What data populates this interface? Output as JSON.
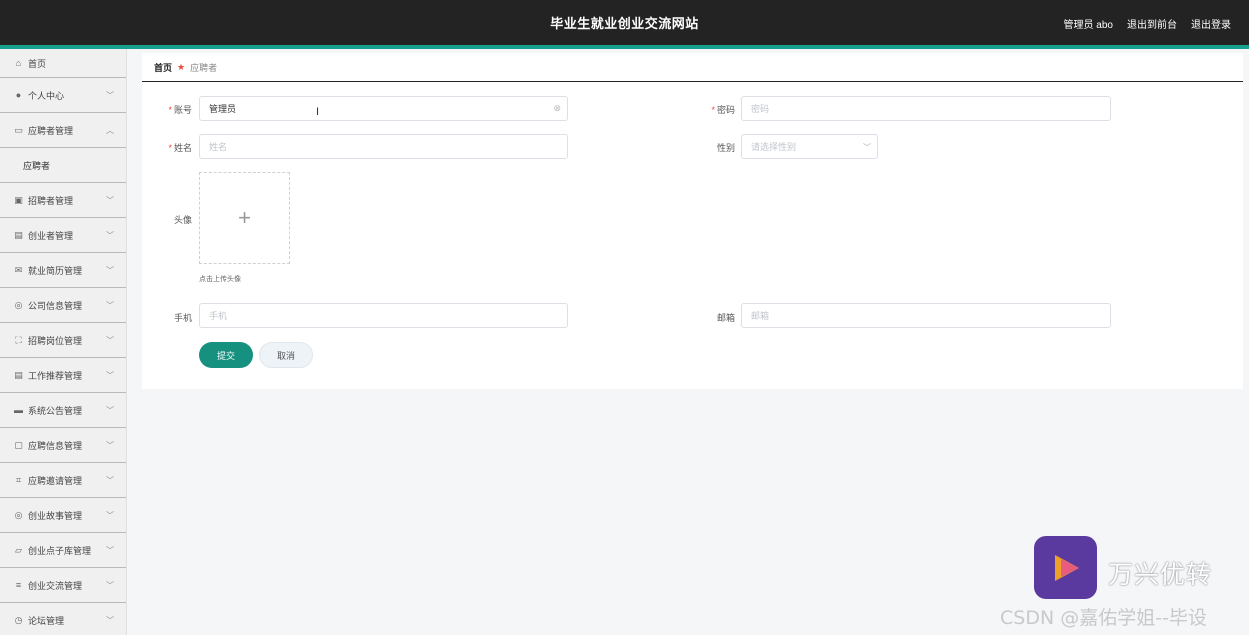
{
  "header": {
    "title": "毕业生就业创业交流网站",
    "user_label": "管理员 abo",
    "back_to_front": "退出到前台",
    "logout": "退出登录"
  },
  "sidebar": {
    "items": [
      {
        "label": "首页",
        "icon": "home-icon",
        "glyph": "⌂"
      },
      {
        "label": "个人中心",
        "icon": "user-icon",
        "glyph": "●"
      },
      {
        "label": "应聘者管理",
        "icon": "monitor-icon",
        "glyph": "▭"
      },
      {
        "label": "应聘者",
        "icon": "",
        "glyph": ""
      },
      {
        "label": "招聘者管理",
        "icon": "doc-icon",
        "glyph": "▣"
      },
      {
        "label": "创业者管理",
        "icon": "clipboard-icon",
        "glyph": "▤"
      },
      {
        "label": "就业简历管理",
        "icon": "mail-icon",
        "glyph": "✉"
      },
      {
        "label": "公司信息管理",
        "icon": "compass-icon",
        "glyph": "◎"
      },
      {
        "label": "招聘岗位管理",
        "icon": "frame-icon",
        "glyph": "⛶"
      },
      {
        "label": "工作推荐管理",
        "icon": "clipboard-icon",
        "glyph": "▤"
      },
      {
        "label": "系统公告管理",
        "icon": "briefcase-icon",
        "glyph": "▬"
      },
      {
        "label": "应聘信息管理",
        "icon": "chart-icon",
        "glyph": "▢"
      },
      {
        "label": "应聘邀请管理",
        "icon": "crop-icon",
        "glyph": "⌗"
      },
      {
        "label": "创业故事管理",
        "icon": "compass-icon",
        "glyph": "◎"
      },
      {
        "label": "创业点子库管理",
        "icon": "chat-icon",
        "glyph": "▱"
      },
      {
        "label": "创业交流管理",
        "icon": "list-icon",
        "glyph": "≡"
      },
      {
        "label": "论坛管理",
        "icon": "clock-icon",
        "glyph": "◷"
      }
    ]
  },
  "breadcrumb": {
    "home": "首页",
    "current": "应聘者"
  },
  "form": {
    "account_label": "账号",
    "account_value": "管理员",
    "password_label": "密码",
    "password_placeholder": "密码",
    "name_label": "姓名",
    "name_placeholder": "姓名",
    "gender_label": "性别",
    "gender_placeholder": "请选择性别",
    "avatar_label": "头像",
    "avatar_tip": "点击上传头像",
    "phone_label": "手机",
    "phone_placeholder": "手机",
    "email_label": "邮箱",
    "email_placeholder": "邮箱",
    "submit": "提交",
    "cancel": "取消"
  },
  "watermark": {
    "brand": "万兴优转",
    "csdn": "CSDN @嘉佑学姐--毕设"
  },
  "colors": {
    "accent": "#17a08f",
    "primary_button": "#16917f",
    "header_bg": "#232323"
  }
}
